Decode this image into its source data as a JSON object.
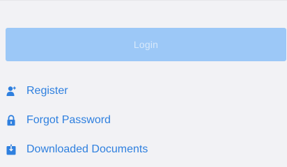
{
  "login": {
    "label": "Login"
  },
  "menu": {
    "items": [
      {
        "label": "Register",
        "icon": "user-add-icon"
      },
      {
        "label": "Forgot Password",
        "icon": "lock-icon"
      },
      {
        "label": "Downloaded Documents",
        "icon": "download-box-icon"
      }
    ]
  },
  "colors": {
    "background": "#f2f2f5",
    "login_button": "#9cc8f7",
    "login_text": "#d8e9fb",
    "link_blue": "#2f80df"
  }
}
